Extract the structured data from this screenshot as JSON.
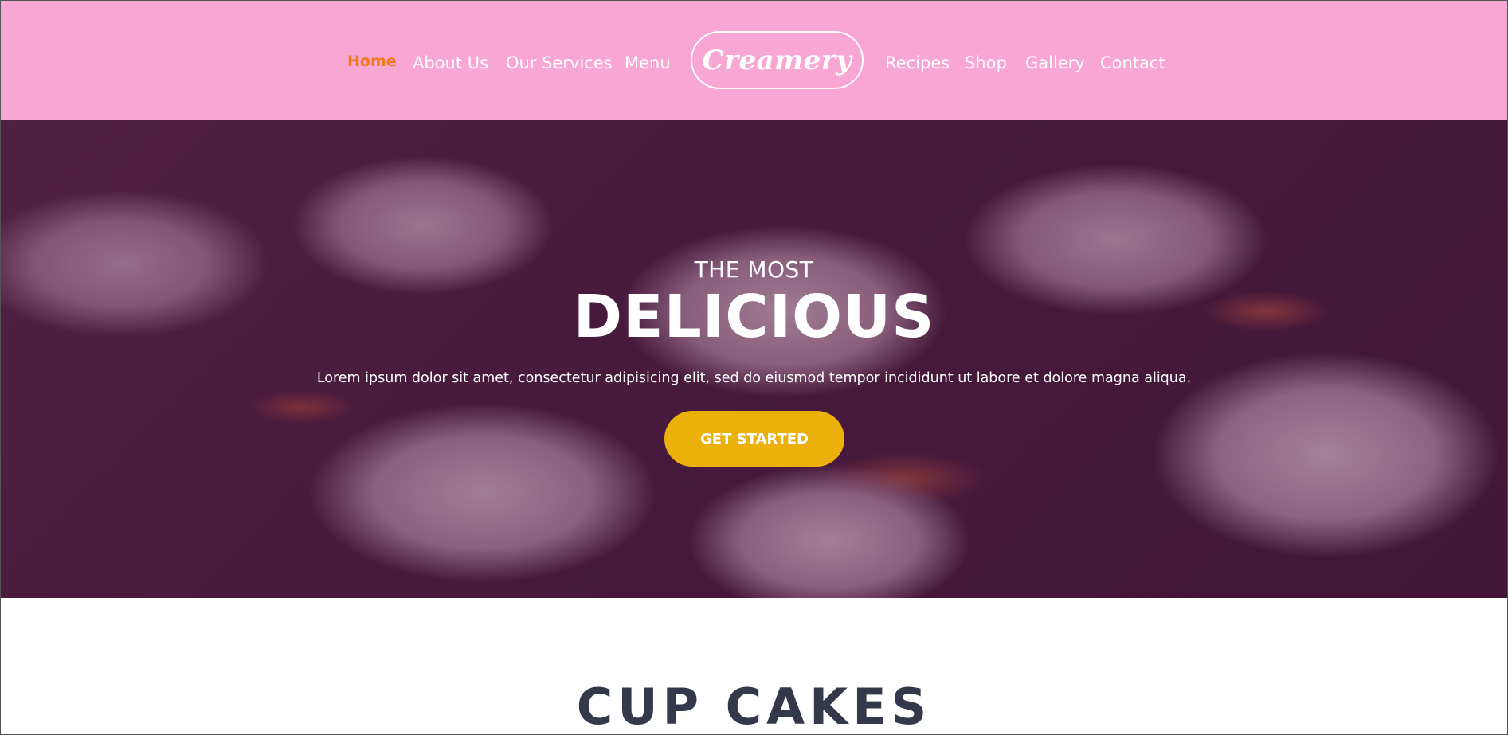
{
  "nav": {
    "left_items": [
      {
        "label": "Home",
        "active": true
      },
      {
        "label": "About Us"
      },
      {
        "label": "Our Services"
      },
      {
        "label": "Menu"
      }
    ],
    "logo": "Creamery",
    "right_items": [
      {
        "label": "Recipes"
      },
      {
        "label": "Shop"
      },
      {
        "label": "Gallery"
      },
      {
        "label": "Contact"
      }
    ]
  },
  "hero": {
    "kicker": "THE MOST",
    "title": "DELICIOUS",
    "text": "Lorem ipsum dolor sit amet, consectetur adipisicing elit, sed do eiusmod tempor incididunt ut labore et dolore magna aliqua.",
    "button": "GET STARTED"
  },
  "section": {
    "title": "CUP CAKES"
  },
  "colors": {
    "nav_bg": "#f8a6d4",
    "active_link": "#f07a1c",
    "button_bg": "#ebb009",
    "section_title": "#33394a"
  }
}
